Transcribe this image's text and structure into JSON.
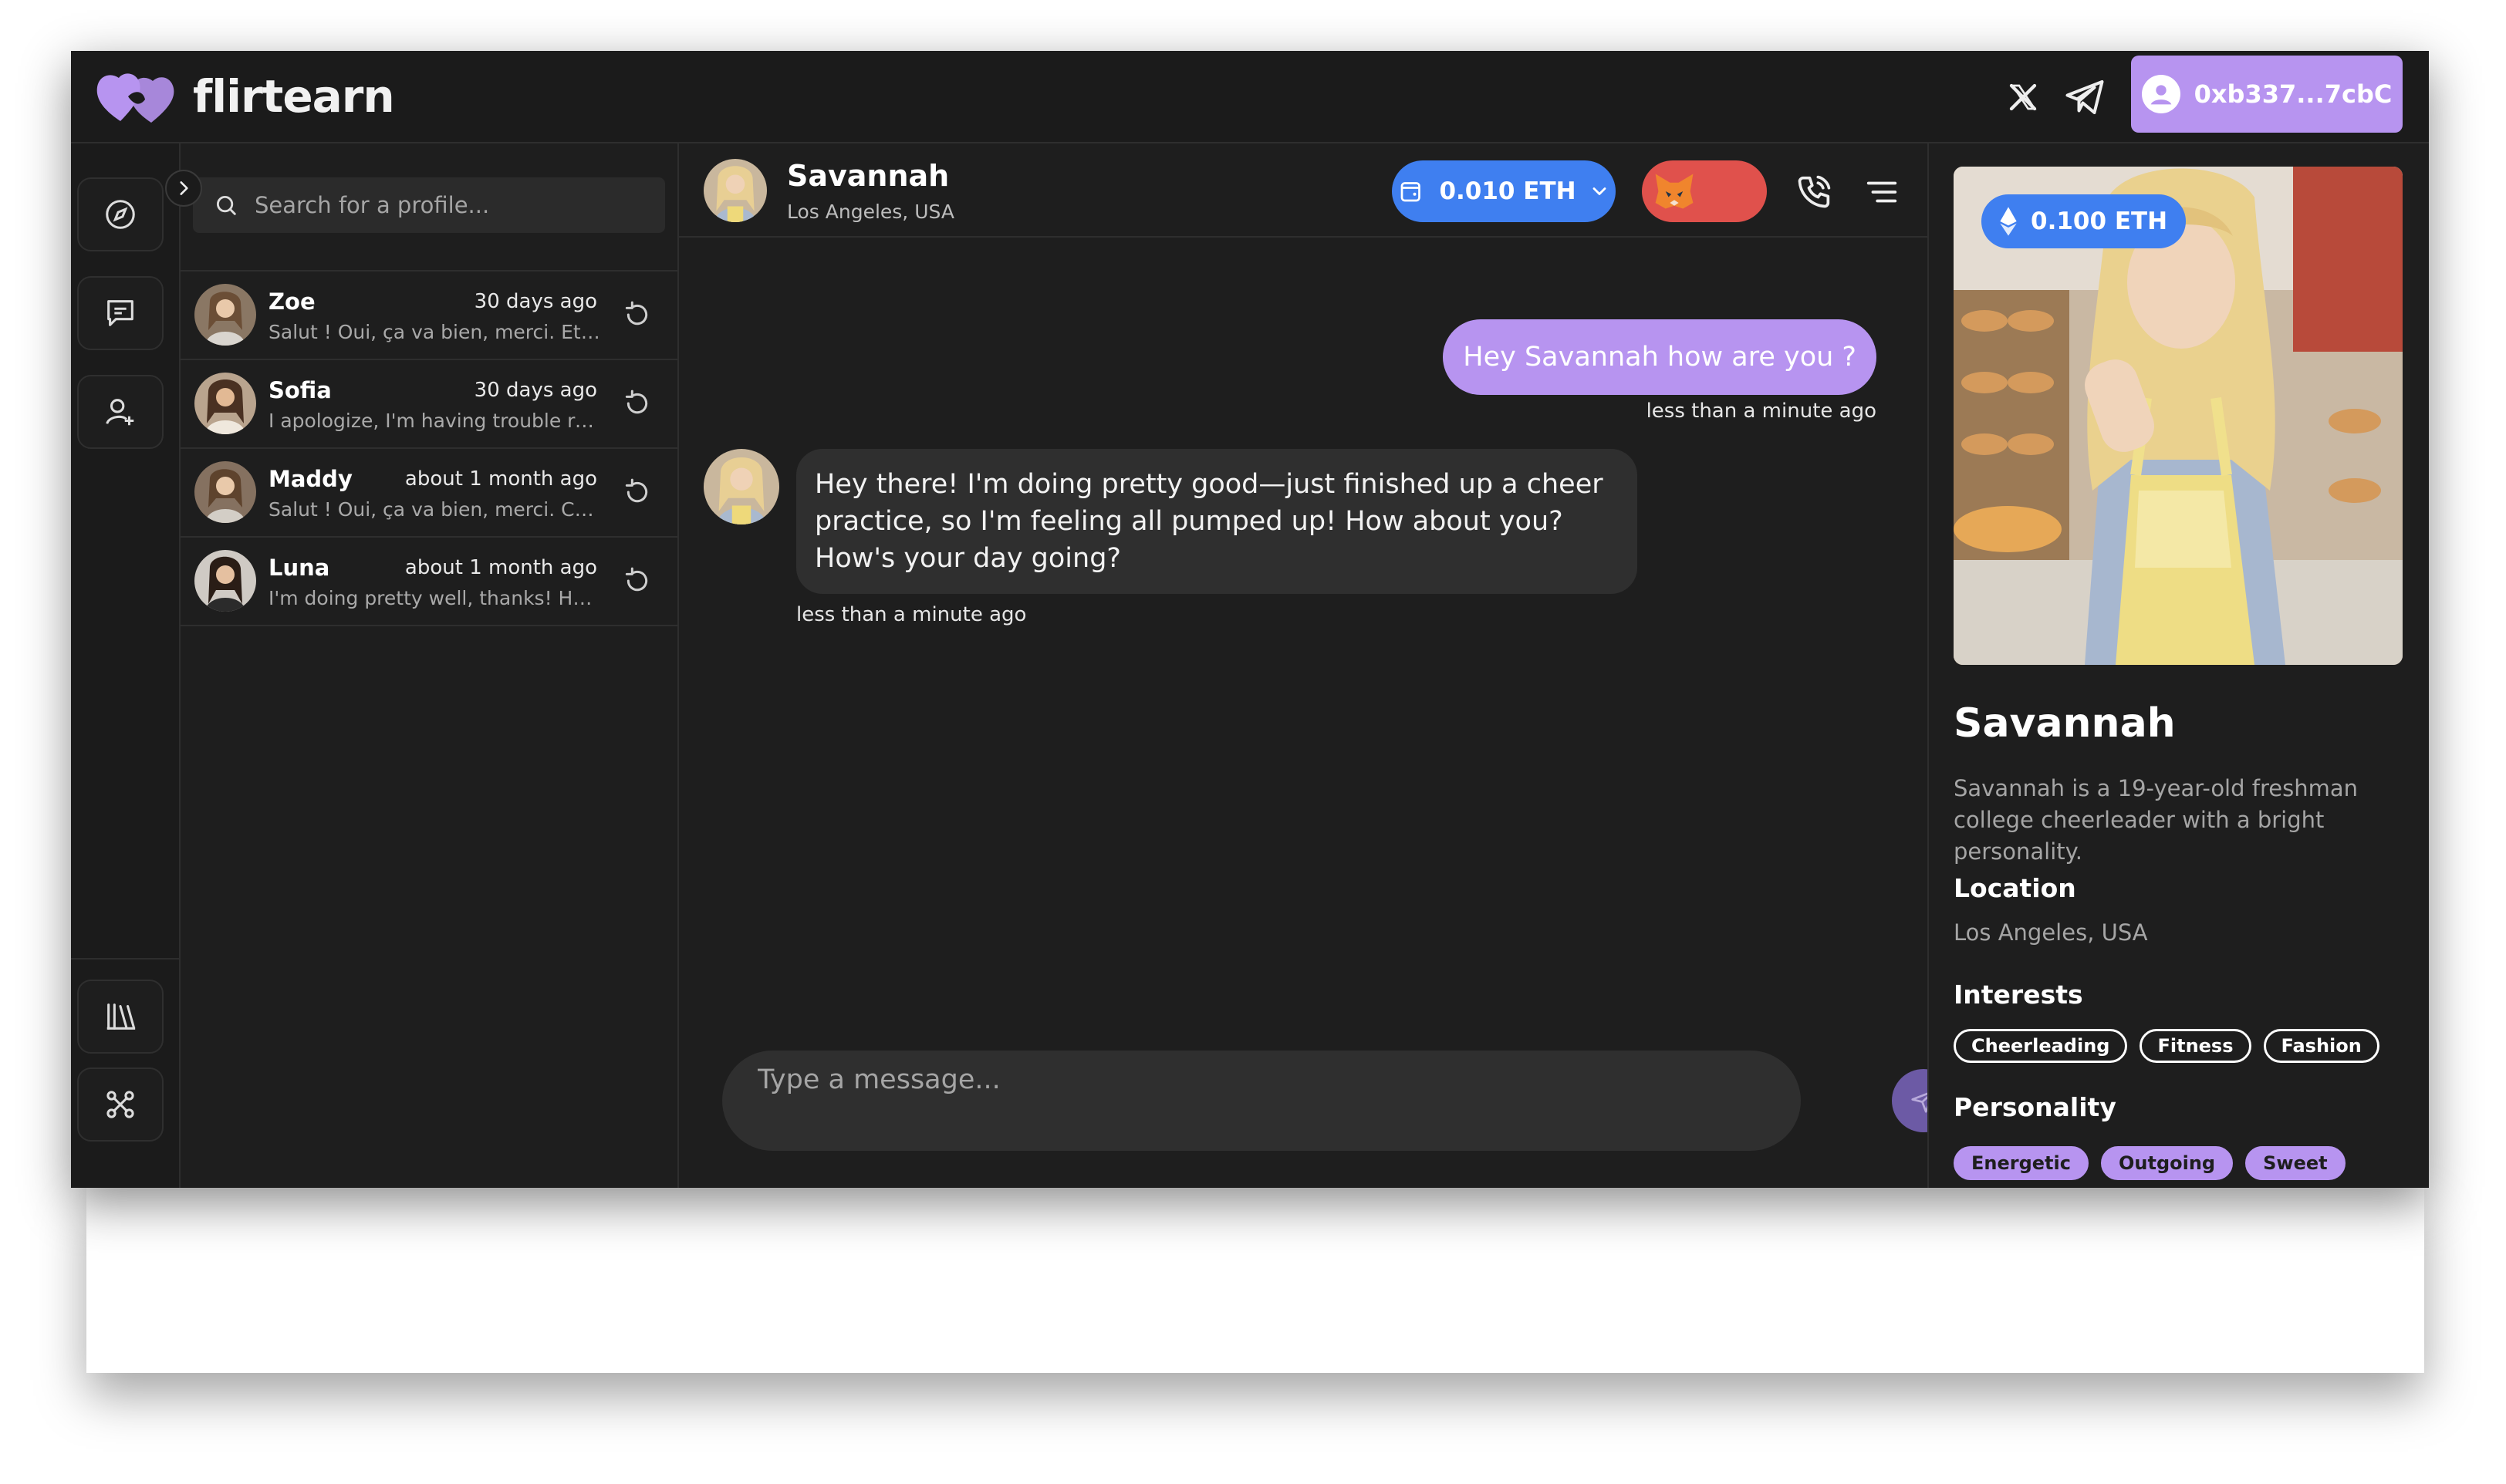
{
  "brand": {
    "name": "flirtearn"
  },
  "topbar": {
    "wallet_address": "0xb337...7cbC"
  },
  "search": {
    "placeholder": "Search for a profile..."
  },
  "conversations": [
    {
      "name": "Zoe",
      "time": "30 days ago",
      "preview": "Salut ! Oui, ça va bien, merci. Et to..."
    },
    {
      "name": "Sofia",
      "time": "30 days ago",
      "preview": "I apologize, I'm having trouble res..."
    },
    {
      "name": "Maddy",
      "time": "about 1 month ago",
      "preview": "Salut ! Oui, ça va bien, merci. Co..."
    },
    {
      "name": "Luna",
      "time": "about 1 month ago",
      "preview": "I'm doing pretty well, thanks! How..."
    }
  ],
  "chat": {
    "name": "Savannah",
    "location": "Los Angeles, USA",
    "balance": "0.010 ETH",
    "messages": [
      {
        "text": "Hey Savannah how are you ?",
        "time": "less than a minute ago"
      },
      {
        "text": "Hey there! I'm doing pretty good—just finished up a cheer practice, so I'm feeling all pumped up! How about you? How's your day going?",
        "time": "less than a minute ago"
      }
    ],
    "composer_placeholder": "Type a message..."
  },
  "profile": {
    "price": "0.100 ETH",
    "name": "Savannah",
    "bio": "Savannah is a 19-year-old freshman college cheerleader with a bright personality.",
    "location_heading": "Location",
    "location": "Los Angeles, USA",
    "interests_heading": "Interests",
    "interests": [
      "Cheerleading",
      "Fitness",
      "Fashion"
    ],
    "personality_heading": "Personality",
    "personality": [
      "Energetic",
      "Outgoing",
      "Sweet"
    ]
  },
  "colors": {
    "accent_purple": "#b794f0",
    "eth_blue": "#3f7ff0",
    "metamask_red": "#e0514c",
    "background": "#1e1e1e"
  },
  "icons": [
    "x-logo-icon",
    "telegram-icon",
    "user-circle-icon",
    "compass-icon",
    "chat-icon",
    "add-user-icon",
    "library-icon",
    "network-icon",
    "chevron-right-icon",
    "search-icon",
    "refresh-icon",
    "wallet-icon",
    "chevron-down-icon",
    "metamask-fox-icon",
    "phone-icon",
    "menu-icon",
    "send-icon",
    "ethereum-icon"
  ]
}
